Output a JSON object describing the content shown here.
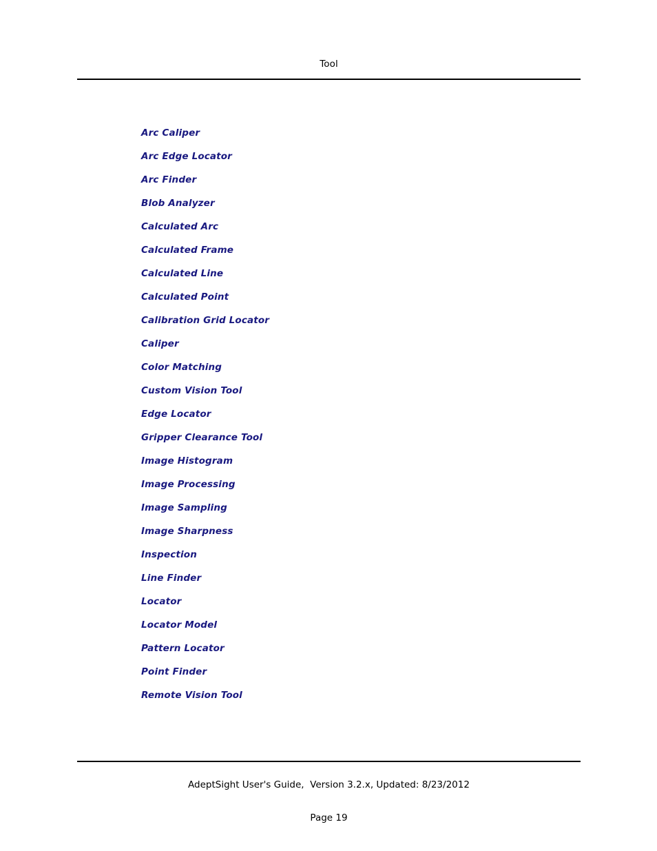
{
  "document": {
    "header": {
      "title": "Tool"
    },
    "body": {
      "links": [
        {
          "label": "Arc Caliper"
        },
        {
          "label": "Arc Edge Locator"
        },
        {
          "label": "Arc Finder"
        },
        {
          "label": "Blob Analyzer"
        },
        {
          "label": "Calculated Arc"
        },
        {
          "label": "Calculated Frame"
        },
        {
          "label": "Calculated Line"
        },
        {
          "label": "Calculated Point"
        },
        {
          "label": "Calibration Grid Locator"
        },
        {
          "label": "Caliper"
        },
        {
          "label": "Color Matching"
        },
        {
          "label": "Custom Vision Tool"
        },
        {
          "label": "Edge Locator"
        },
        {
          "label": "Gripper Clearance Tool"
        },
        {
          "label": "Image Histogram"
        },
        {
          "label": "Image Processing"
        },
        {
          "label": "Image Sampling"
        },
        {
          "label": "Image Sharpness"
        },
        {
          "label": "Inspection"
        },
        {
          "label": "Line Finder"
        },
        {
          "label": "Locator"
        },
        {
          "label": "Locator Model"
        },
        {
          "label": "Pattern Locator"
        },
        {
          "label": "Point Finder"
        },
        {
          "label": "Remote Vision Tool"
        }
      ]
    },
    "footer": {
      "guide_line": "AdeptSight User's Guide,  Version 3.2.x, Updated: 8/23/2012",
      "page_label": "Page 19"
    },
    "colors": {
      "link": "#191980",
      "text": "#000000",
      "rule": "#000000",
      "background": "#ffffff"
    }
  }
}
